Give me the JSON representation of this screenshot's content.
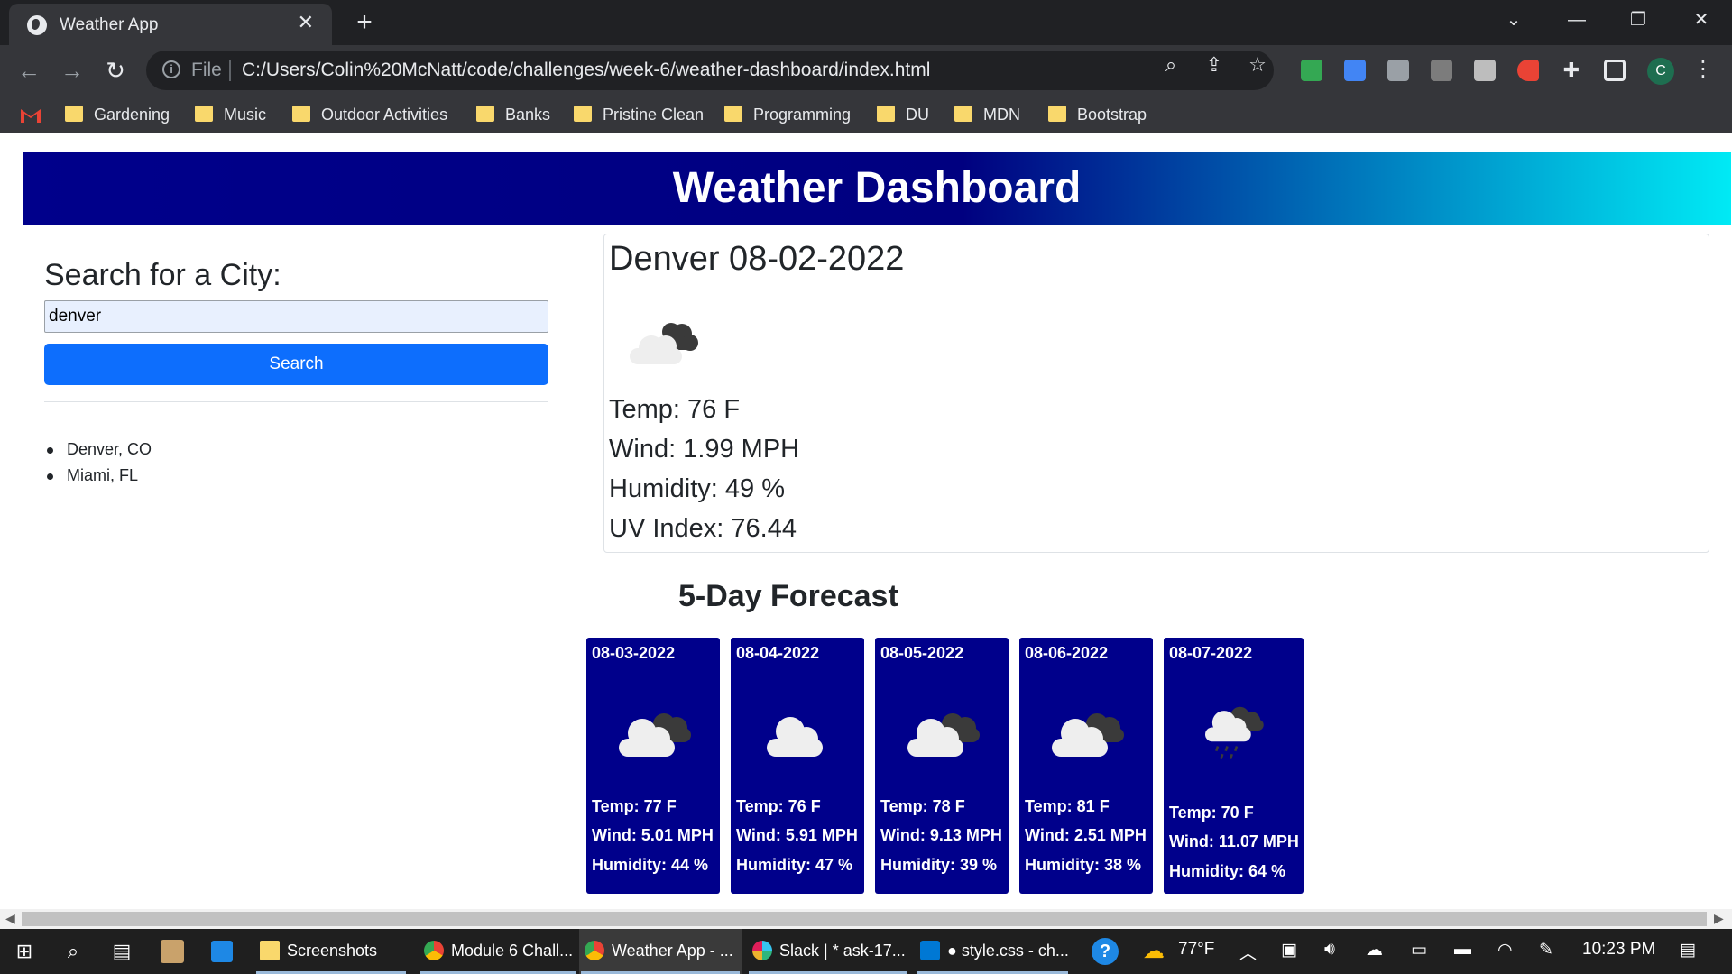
{
  "browser": {
    "tab_title": "Weather App",
    "tab_close": "✕",
    "new_tab": "+",
    "url_scheme": "File",
    "url": "C:/Users/Colin%20McNatt/code/challenges/week-6/weather-dashboard/index.html",
    "profile_initial": "C",
    "bookmarks": [
      "Gardening",
      "Music",
      "Outdoor Activities",
      "Banks",
      "Pristine Clean",
      "Programming",
      "DU",
      "MDN",
      "Bootstrap"
    ]
  },
  "page": {
    "header_title": "Weather Dashboard",
    "search": {
      "title": "Search for a City:",
      "value": "denver",
      "button_label": "Search"
    },
    "history": [
      "Denver, CO",
      "Miami, FL"
    ],
    "current": {
      "city_date": "Denver 08-02-2022",
      "icon": "partly-cloudy-icon",
      "temp": "Temp: 76 F",
      "wind": "Wind: 1.99 MPH",
      "humidity": "Humidity: 49 %",
      "uv": "UV Index: 76.44"
    },
    "forecast_title": "5-Day Forecast",
    "forecast": [
      {
        "date": "08-03-2022",
        "icon": "broken-clouds-icon",
        "temp": "Temp: 77 F",
        "wind": "Wind: 5.01 MPH",
        "humidity": "Humidity: 44 %"
      },
      {
        "date": "08-04-2022",
        "icon": "cloud-icon",
        "temp": "Temp: 76 F",
        "wind": "Wind: 5.91 MPH",
        "humidity": "Humidity: 47 %"
      },
      {
        "date": "08-05-2022",
        "icon": "broken-clouds-icon",
        "temp": "Temp: 78 F",
        "wind": "Wind: 9.13 MPH",
        "humidity": "Humidity: 39 %"
      },
      {
        "date": "08-06-2022",
        "icon": "broken-clouds-icon",
        "temp": "Temp: 81 F",
        "wind": "Wind: 2.51 MPH",
        "humidity": "Humidity: 38 %"
      },
      {
        "date": "08-07-2022",
        "icon": "rain-icon",
        "temp": "Temp: 70 F",
        "wind": "Wind: 11.07 MPH",
        "humidity": "Humidity: 64 %"
      }
    ]
  },
  "taskbar": {
    "apps": [
      {
        "label": "Screenshots",
        "icon": "folder-icon"
      },
      {
        "label": "Module 6 Chall...",
        "icon": "chrome-icon"
      },
      {
        "label": "Weather App - ...",
        "icon": "chrome-icon"
      },
      {
        "label": "Slack | * ask-17...",
        "icon": "slack-icon"
      },
      {
        "label": "● style.css - ch...",
        "icon": "vscode-icon"
      }
    ],
    "weather_temp": "77°F",
    "time": "10:23 PM"
  },
  "colors": {
    "header_start": "#00008b",
    "header_end": "#00eaf5",
    "card_bg": "#00008b",
    "button": "#0d6efd"
  }
}
